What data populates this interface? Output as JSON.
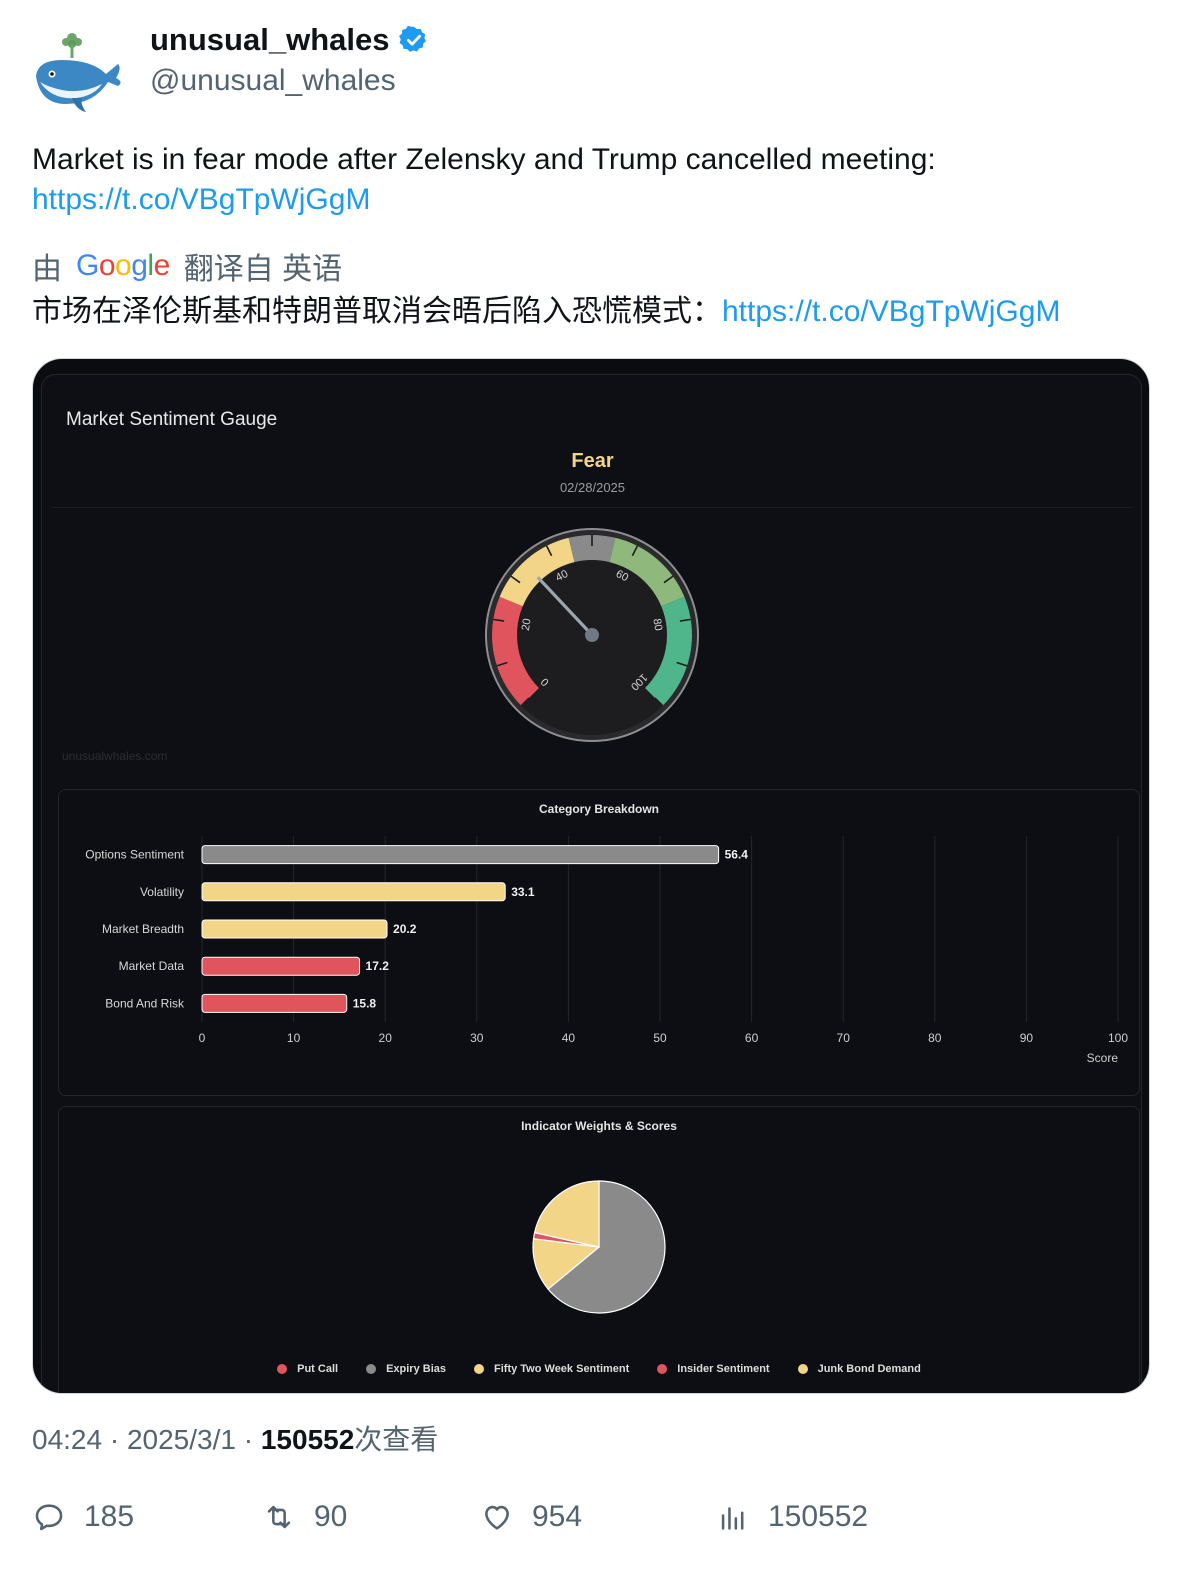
{
  "author": {
    "display_name": "unusual_whales",
    "handle": "@unusual_whales",
    "avatar_icon": "whale-logo-icon",
    "verified_icon": "verified-badge-icon"
  },
  "tweet": {
    "text": "Market is in fear mode after Zelensky and Trump cancelled meeting:",
    "link": "https://t.co/VBgTpWjGgM",
    "translation_prefix": "由",
    "translation_provider": "Google",
    "translation_suffix": "翻译自 英语",
    "translated_text": "市场在泽伦斯基和特朗普取消会晤后陷入恐慌模式：",
    "translated_link": "https://t.co/VBgTpWjGgM"
  },
  "media": {
    "panel_title": "Market Sentiment Gauge",
    "sentiment": "Fear",
    "date": "02/28/2025",
    "watermark": "unusualwhales.com",
    "gauge": {
      "value": 34,
      "min": 0,
      "max": 100,
      "tick_labels": [
        "0",
        "20",
        "40",
        "60",
        "80",
        "100"
      ],
      "zones": [
        {
          "from": 0,
          "to": 25,
          "color": "#e0545e"
        },
        {
          "from": 25,
          "to": 45,
          "color": "#f3d587"
        },
        {
          "from": 45,
          "to": 55,
          "color": "#8a8a8a"
        },
        {
          "from": 55,
          "to": 75,
          "color": "#8fb87c"
        },
        {
          "from": 75,
          "to": 100,
          "color": "#4fb58a"
        }
      ]
    },
    "category_chart": {
      "title": "Category Breakdown",
      "xlabel": "Score"
    },
    "pie_chart": {
      "title": "Indicator Weights & Scores"
    }
  },
  "chart_data": [
    {
      "type": "bar",
      "orientation": "horizontal",
      "title": "Category Breakdown",
      "categories": [
        "Options Sentiment",
        "Volatility",
        "Market Breadth",
        "Market Data",
        "Bond And Risk"
      ],
      "values": [
        56.4,
        33.1,
        20.2,
        17.2,
        15.8
      ],
      "colors": [
        "#8a8a8a",
        "#f3d587",
        "#f3d587",
        "#e0545e",
        "#e0545e"
      ],
      "xlabel": "Score",
      "ylabel": "",
      "xlim": [
        0,
        100
      ],
      "xticks": [
        "0",
        "10",
        "20",
        "30",
        "40",
        "50",
        "60",
        "70",
        "80",
        "90",
        "100"
      ],
      "grid": true
    },
    {
      "type": "pie",
      "title": "Indicator Weights & Scores",
      "labels": [
        "Put Call",
        "Expiry Bias",
        "Fifty Two Week Sentiment",
        "Insider Sentiment",
        "Junk Bond Demand"
      ],
      "values": [
        0,
        64,
        13,
        1.5,
        21.5
      ],
      "colors": [
        "#e0545e",
        "#8a8a8a",
        "#f3d587",
        "#e0545e",
        "#f3d587"
      ],
      "legend": "bottom"
    }
  ],
  "footer": {
    "time": "04:24",
    "date": "2025/3/1",
    "views": "150552",
    "views_suffix": "次查看"
  },
  "actions": {
    "replies": "185",
    "retweets": "90",
    "likes": "954",
    "views": "150552"
  }
}
